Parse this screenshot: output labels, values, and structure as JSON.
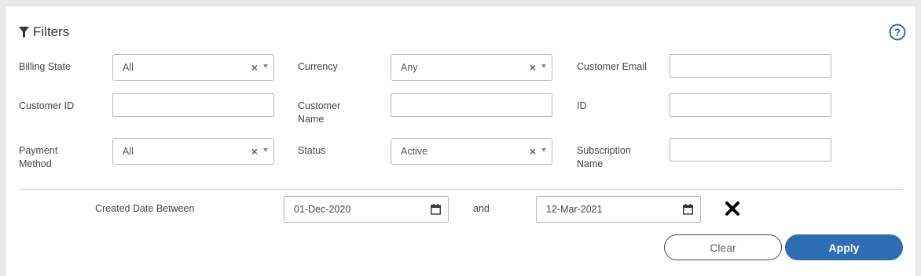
{
  "header": {
    "title": "Filters",
    "filter_icon": "funnel-icon",
    "help_icon": "help-circle-icon"
  },
  "filters": {
    "billing_state": {
      "label": "Billing State",
      "value": "All"
    },
    "currency": {
      "label": "Currency",
      "value": "Any"
    },
    "customer_email": {
      "label": "Customer Email",
      "value": ""
    },
    "customer_id": {
      "label": "Customer ID",
      "value": ""
    },
    "customer_name": {
      "label": "Customer Name",
      "value": ""
    },
    "id": {
      "label": "ID",
      "value": ""
    },
    "payment_method": {
      "label": "Payment Method",
      "value": "All"
    },
    "status": {
      "label": "Status",
      "value": "Active"
    },
    "subscription_name": {
      "label": "Subscription Name",
      "value": ""
    },
    "clear_symbol": "×"
  },
  "date_range": {
    "label": "Created Date Between",
    "from": "01-Dec-2020",
    "and_label": "and",
    "to": "12-Mar-2021",
    "calendar_icon": "calendar-icon",
    "remove_icon": "close-icon"
  },
  "actions": {
    "clear_label": "Clear",
    "apply_label": "Apply"
  },
  "colors": {
    "primary": "#2f6db3",
    "border": "#b8b8b8",
    "text": "#444444"
  }
}
